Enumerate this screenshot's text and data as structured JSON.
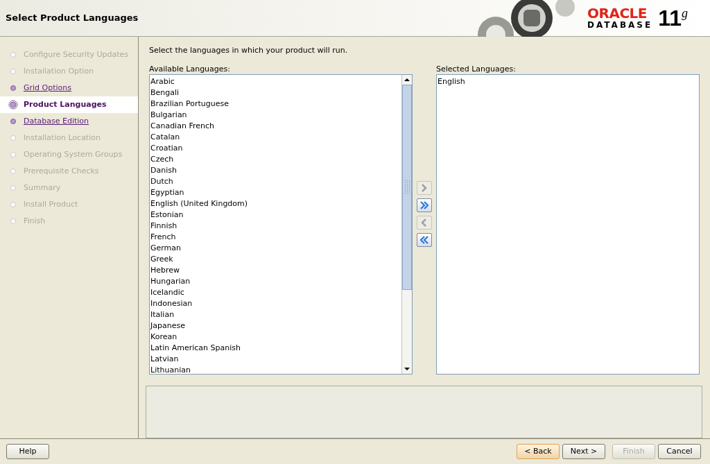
{
  "header": {
    "title": "Select Product Languages",
    "logo_brand": "ORACLE",
    "logo_product": "DATABASE",
    "logo_version": "11",
    "logo_suffix": "g"
  },
  "steps": [
    {
      "label": "Configure Security Updates",
      "kind": "disabled",
      "selected": false
    },
    {
      "label": "Installation Option",
      "kind": "disabled",
      "selected": false
    },
    {
      "label": "Grid Options",
      "kind": "visited",
      "selected": false
    },
    {
      "label": "Product Languages",
      "kind": "current",
      "selected": true
    },
    {
      "label": "Database Edition",
      "kind": "visited",
      "selected": false
    },
    {
      "label": "Installation Location",
      "kind": "disabled",
      "selected": false
    },
    {
      "label": "Operating System Groups",
      "kind": "disabled",
      "selected": false
    },
    {
      "label": "Prerequisite Checks",
      "kind": "disabled",
      "selected": false
    },
    {
      "label": "Summary",
      "kind": "disabled",
      "selected": false
    },
    {
      "label": "Install Product",
      "kind": "disabled",
      "selected": false
    },
    {
      "label": "Finish",
      "kind": "disabled",
      "selected": false
    }
  ],
  "instruction": "Select the languages in which your product will run.",
  "available": {
    "label": "Available Languages:",
    "items": [
      "Arabic",
      "Bengali",
      "Brazilian Portuguese",
      "Bulgarian",
      "Canadian French",
      "Catalan",
      "Croatian",
      "Czech",
      "Danish",
      "Dutch",
      "Egyptian",
      "English (United Kingdom)",
      "Estonian",
      "Finnish",
      "French",
      "German",
      "Greek",
      "Hebrew",
      "Hungarian",
      "Icelandic",
      "Indonesian",
      "Italian",
      "Japanese",
      "Korean",
      "Latin American Spanish",
      "Latvian",
      "Lithuanian"
    ]
  },
  "transfer_buttons": [
    {
      "kind": "add",
      "disabled": true
    },
    {
      "kind": "add_all",
      "disabled": false
    },
    {
      "kind": "remove",
      "disabled": true
    },
    {
      "kind": "remove_all",
      "disabled": false
    }
  ],
  "selected": {
    "label": "Selected Languages:",
    "items": [
      "English"
    ]
  },
  "buttons": {
    "help": {
      "label": "Help",
      "disabled": false
    },
    "nav": [
      {
        "label": "< Back",
        "disabled": false,
        "focused": true
      },
      {
        "label": "Next >",
        "disabled": false,
        "focused": false
      },
      {
        "label": "Finish",
        "disabled": true,
        "focused": false
      },
      {
        "label": "Cancel",
        "disabled": false,
        "focused": false
      }
    ]
  }
}
